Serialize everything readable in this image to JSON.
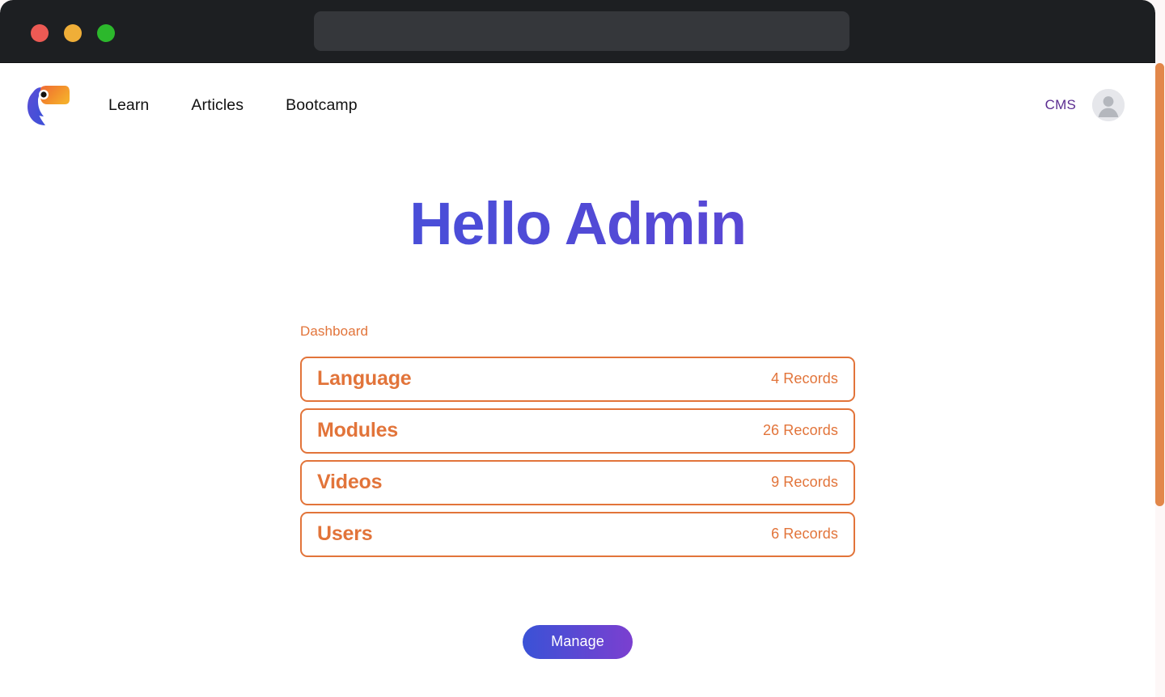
{
  "browser": {
    "traffic_lights": [
      {
        "name": "close",
        "color": "#ec5a54"
      },
      {
        "name": "minimize",
        "color": "#efae38"
      },
      {
        "name": "maximize",
        "color": "#2cb82c"
      }
    ],
    "address_bar": {
      "value": "",
      "placeholder": ""
    }
  },
  "header": {
    "logo_alt": "toucan-logo",
    "nav": [
      {
        "label": "Learn"
      },
      {
        "label": "Articles"
      },
      {
        "label": "Bootcamp"
      }
    ],
    "cms_label": "CMS",
    "avatar_alt": "user-avatar"
  },
  "main": {
    "title": "Hello Admin",
    "dashboard_label": "Dashboard",
    "cards": [
      {
        "title": "Language",
        "count": "4 Records"
      },
      {
        "title": "Modules",
        "count": "26 Records"
      },
      {
        "title": "Videos",
        "count": "9 Records"
      },
      {
        "title": "Users",
        "count": "6 Records"
      }
    ],
    "manage_button": "Manage"
  },
  "colors": {
    "accent_orange": "#e2743a",
    "brand_blue": "#3656dc",
    "brand_purple": "#6c3fd1",
    "cms_purple": "#5b2d91",
    "chrome_dark": "#1d1f22",
    "scrollbar_orange": "#e2874a"
  }
}
